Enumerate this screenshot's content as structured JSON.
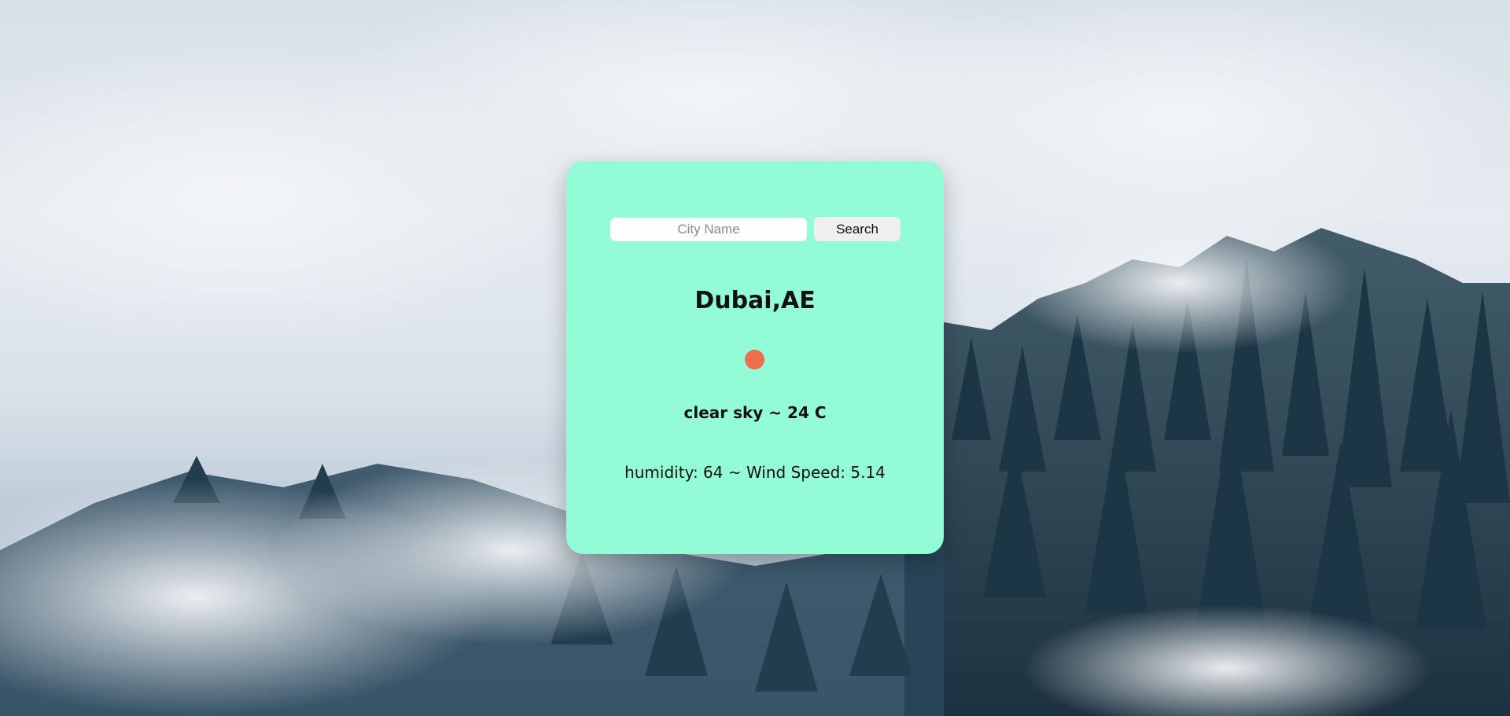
{
  "search": {
    "placeholder": "City Name",
    "value": "",
    "button_label": "Search"
  },
  "weather": {
    "city": "Dubai,AE",
    "icon": "clear-sky-sun-icon",
    "description": "clear sky ~ 24 C",
    "details": "humidity: 64 ~ Wind Speed: 5.14"
  },
  "colors": {
    "card": "#93fbd6",
    "icon": "#ec6e4c"
  },
  "background": {
    "scene": "misty-forest"
  }
}
